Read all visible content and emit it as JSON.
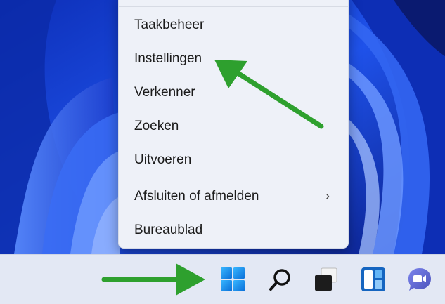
{
  "context_menu": {
    "items": [
      {
        "label": "Taakbeheer"
      },
      {
        "label": "Instellingen"
      },
      {
        "label": "Verkenner"
      },
      {
        "label": "Zoeken"
      },
      {
        "label": "Uitvoeren"
      },
      {
        "label": "Afsluiten of afmelden",
        "submenu_indicator": "›"
      },
      {
        "label": "Bureaublad"
      }
    ]
  },
  "taskbar": {
    "icons": [
      "windows-start-icon",
      "search-icon",
      "task-view-icon",
      "widgets-icon",
      "teams-chat-icon"
    ]
  },
  "colors": {
    "arrow": "#2ea02e",
    "menu_bg": "#eef1f8",
    "taskbar_bg": "#e3e8f4",
    "wallpaper_blue": "#1a3fd0"
  }
}
